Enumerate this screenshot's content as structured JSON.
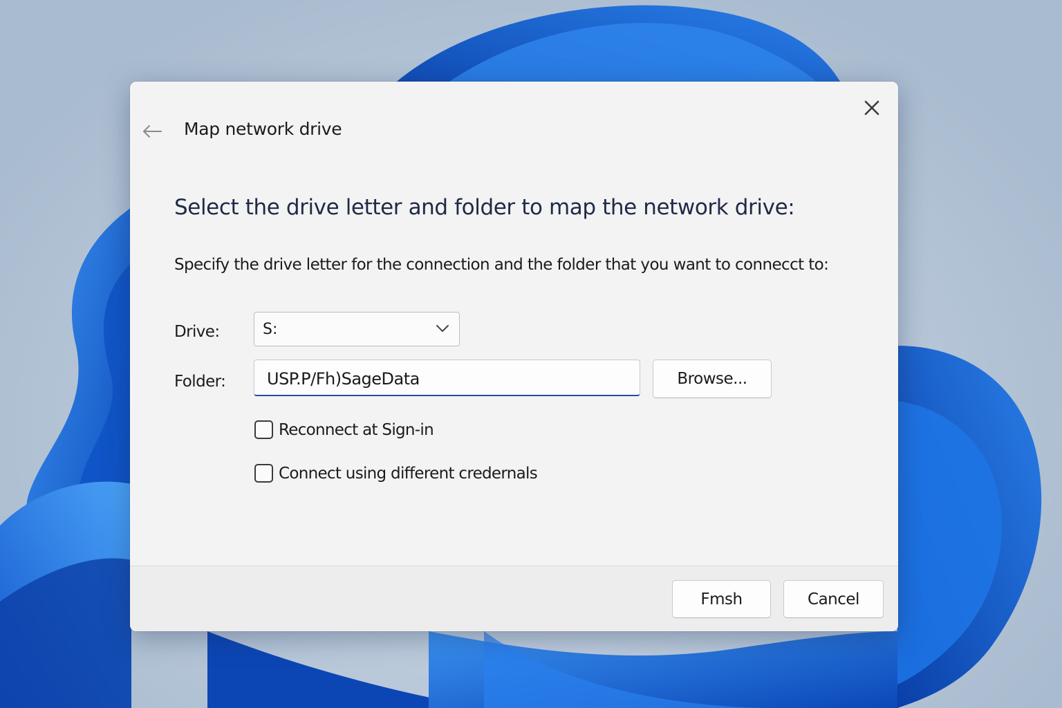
{
  "dialog": {
    "title": "Map network drive",
    "heading": "Select the drive letter and folder to map the network drive:",
    "instructions": "Specify the drive letter for the connection and the folder that you want to connecct to:",
    "back_icon": "arrow-left-icon",
    "close_icon": "close-icon"
  },
  "form": {
    "drive_label": "Drive:",
    "drive_value": "S:",
    "folder_label": "Folder:",
    "folder_value": "USP.P/Fh)SageData",
    "browse_label": "Browse...",
    "reconnect_label": "Reconnect at Sign-in",
    "reconnect_checked": false,
    "credentials_label": "Connect using different credernals",
    "credentials_checked": false
  },
  "footer": {
    "finish_label": "Fmsh",
    "cancel_label": "Cancel"
  },
  "colors": {
    "accent": "#1f4fa8",
    "wallpaper_blue": "#1a6fe0",
    "dialog_bg": "#f3f3f3"
  }
}
